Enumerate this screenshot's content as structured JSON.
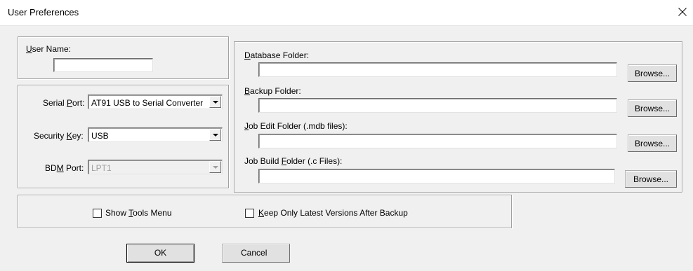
{
  "window": {
    "title": "User Preferences",
    "close_symbol": "X"
  },
  "user_name": {
    "label_u": "U",
    "label_rest": "ser Name:",
    "value": ""
  },
  "serial_port": {
    "label_pre": "Serial ",
    "label_u": "P",
    "label_rest": "ort:",
    "value": "AT91 USB to Serial Converter"
  },
  "security_key": {
    "label_pre": "Security ",
    "label_u": "K",
    "label_rest": "ey:",
    "value": "USB"
  },
  "bdm_port": {
    "label_pre": "BD",
    "label_u": "M",
    "label_rest": " Port:",
    "value": "LPT1"
  },
  "folders": [
    {
      "label_u": "D",
      "label_rest": "atabase Folder:",
      "value": "",
      "browse": "Browse..."
    },
    {
      "label_u": "B",
      "label_rest": "ackup Folder:",
      "value": "",
      "browse": "Browse..."
    },
    {
      "label_u": "J",
      "label_rest": "ob Edit Folder (.mdb files):",
      "value": "",
      "browse": "Browse..."
    },
    {
      "label_pre": "Job Build ",
      "label_u": "F",
      "label_rest": "older (.c Files):",
      "value": "",
      "browse": "Browse..."
    }
  ],
  "options": {
    "show_tools": {
      "label_pre": "Show ",
      "label_u": "T",
      "label_rest": "ools Menu",
      "checked": false
    },
    "keep_latest": {
      "label_u": "K",
      "label_rest": "eep Only Latest Versions After Backup",
      "checked": false
    }
  },
  "buttons": {
    "ok": "OK",
    "cancel": "Cancel"
  }
}
